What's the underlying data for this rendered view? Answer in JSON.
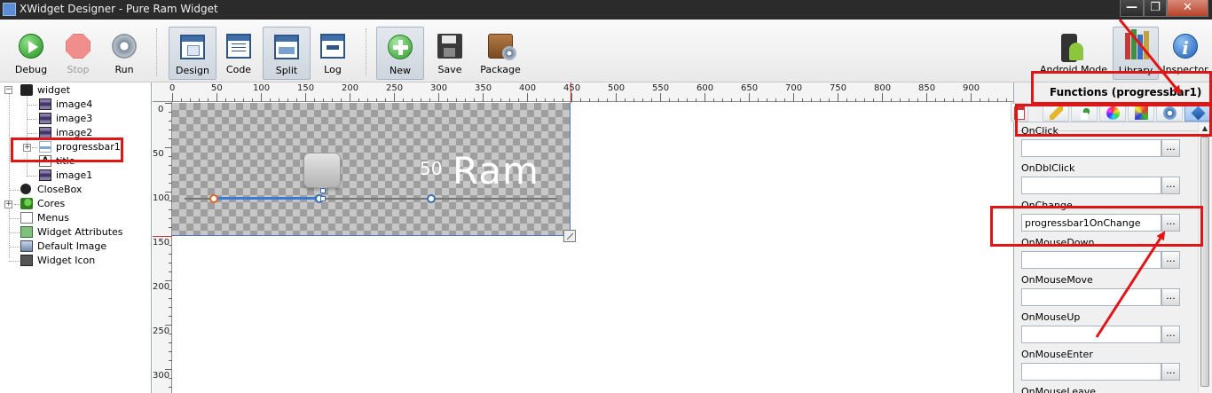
{
  "window": {
    "title": "XWidget Designer - Pure Ram Widget",
    "controls": {
      "minimize": "—",
      "maximize": "❐",
      "close": "✕"
    }
  },
  "toolbar": {
    "debug": "Debug",
    "stop": "Stop",
    "run": "Run",
    "design": "Design",
    "code": "Code",
    "split": "Split",
    "log": "Log",
    "new": "New",
    "save": "Save",
    "package": "Package",
    "android_mode": "Android Mode",
    "library": "Library",
    "inspector": "Inspector"
  },
  "tree": {
    "root": "widget",
    "children": [
      "image4",
      "image3",
      "image2",
      "progressbar1",
      "title",
      "image1"
    ],
    "top_level": [
      "CloseBox",
      "Cores",
      "Menus",
      "Widget Attributes",
      "Default Image",
      "Widget Icon"
    ],
    "expander_open": "−",
    "expander_closed": "+",
    "title_icon_letter": "A"
  },
  "ruler": {
    "top": [
      "0",
      "50",
      "100",
      "150",
      "200",
      "250",
      "300",
      "350",
      "400",
      "450",
      "500",
      "550",
      "600",
      "650",
      "700",
      "750",
      "800",
      "850",
      "900",
      "9"
    ],
    "left": [
      "0",
      "50",
      "100",
      "150",
      "200",
      "250",
      "300"
    ]
  },
  "canvas": {
    "progress_value": "50",
    "title_text": "Ram",
    "progress_fraction": 0.5
  },
  "inspector": {
    "heading": "Functions (progressbar1)",
    "browse_label": "...",
    "events": [
      {
        "label": "OnClick",
        "value": ""
      },
      {
        "label": "OnDblClick",
        "value": ""
      },
      {
        "label": "OnChange",
        "value": "progressbar1OnChange"
      },
      {
        "label": "OnMouseDown",
        "value": ""
      },
      {
        "label": "OnMouseMove",
        "value": ""
      },
      {
        "label": "OnMouseUp",
        "value": ""
      },
      {
        "label": "OnMouseEnter",
        "value": ""
      },
      {
        "label": "OnMouseLeave",
        "value": ""
      }
    ],
    "tabs": [
      "events-tab",
      "ruler-tab",
      "shapes-tab",
      "colors-tab",
      "cube-tab",
      "gear-tab",
      "functions-tab"
    ],
    "scroll_up": "▲"
  },
  "annotations": {
    "color": "#e01515"
  },
  "colors": {
    "titlebar": "#2b2b2b",
    "progress_fill": "#3a7bd5",
    "selection": "#4d79c7"
  }
}
